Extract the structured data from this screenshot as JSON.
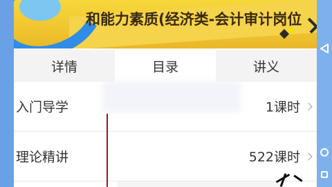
{
  "banner": {
    "title": "和能力素质(经济类-会计审计岗位"
  },
  "tabs": [
    {
      "label": "详情",
      "active": false
    },
    {
      "label": "目录",
      "active": true
    },
    {
      "label": "讲义",
      "active": false
    }
  ],
  "course_list": [
    {
      "title": "入门导学",
      "hours": "1课时"
    },
    {
      "title": "理论精讲",
      "hours": "522课时"
    }
  ],
  "colors": {
    "banner": "#f0c530",
    "accent_blue": "#2f8de6",
    "background": "#6aa0e6"
  }
}
